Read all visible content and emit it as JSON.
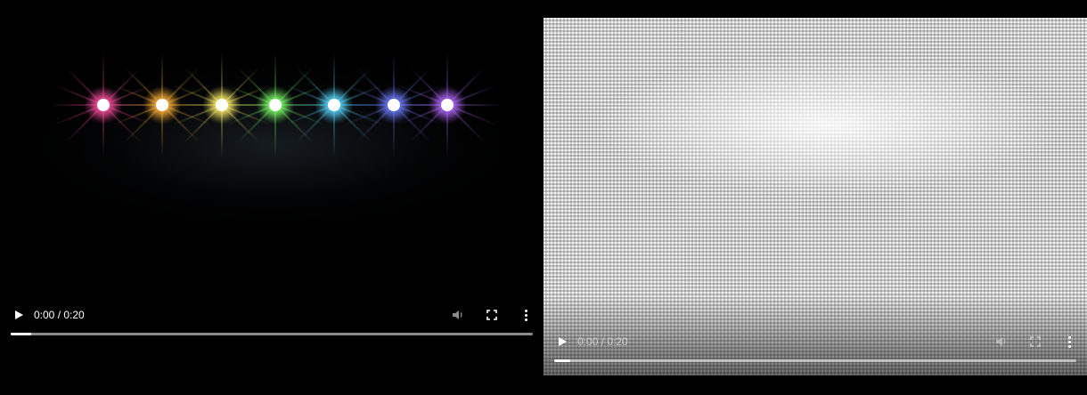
{
  "players": [
    {
      "time_display": "0:00 / 0:20",
      "progress": 0.04
    },
    {
      "time_display": "0:00 / 0:20",
      "progress": 0.03
    }
  ],
  "icons": {
    "play": "play-icon",
    "volume": "volume-icon",
    "fullscreen": "fullscreen-icon",
    "more": "more-options-icon"
  },
  "lights": [
    {
      "color": "#ff4fa0"
    },
    {
      "color": "#ffb33a"
    },
    {
      "color": "#fff06a"
    },
    {
      "color": "#7dff6a"
    },
    {
      "color": "#5ad8ff"
    },
    {
      "color": "#6f7dff"
    },
    {
      "color": "#b36aff"
    }
  ]
}
